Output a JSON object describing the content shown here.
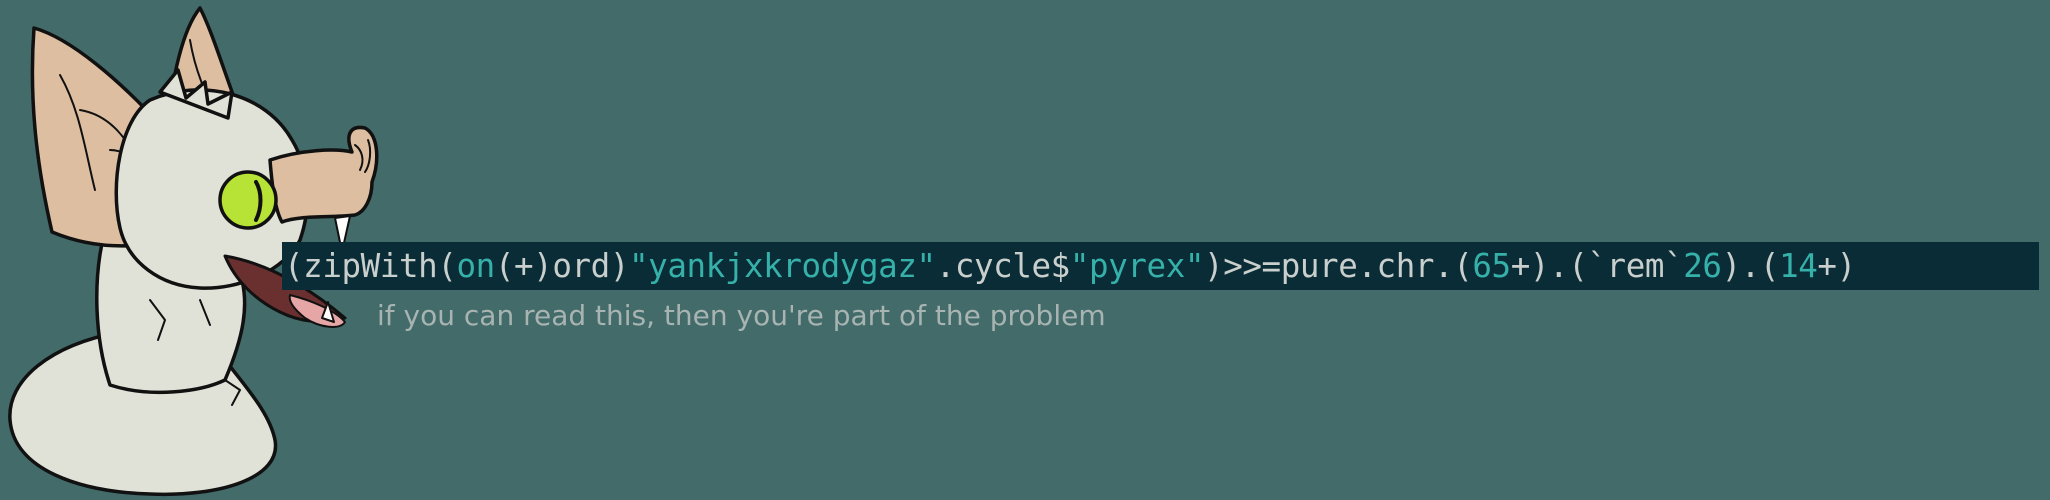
{
  "colors": {
    "background": "#426B6A",
    "code_highlight": "#0A2C36",
    "code_text": "#C9CFCC",
    "code_accent": "#36B1AA",
    "caption_text": "#A7B4B1",
    "fur": "#E1E2D7",
    "skin": "#DDBEA1",
    "eye": "#B7E236",
    "tongue": "#E6A6A6",
    "outline": "#111111"
  },
  "mascot": {
    "icon": "bat-mascot-icon"
  },
  "code": {
    "tokens": [
      {
        "text": "(zipWith(",
        "kind": "plain"
      },
      {
        "text": "on",
        "kind": "accent"
      },
      {
        "text": "(+)ord)",
        "kind": "plain"
      },
      {
        "text": "\"yankjxkrodygaz\"",
        "kind": "accent"
      },
      {
        "text": ".cycle$",
        "kind": "plain"
      },
      {
        "text": "\"pyrex\"",
        "kind": "accent"
      },
      {
        "text": ")>>=pure.chr.(",
        "kind": "plain"
      },
      {
        "text": "65",
        "kind": "accent"
      },
      {
        "text": "+).(`rem`",
        "kind": "plain"
      },
      {
        "text": "26",
        "kind": "accent"
      },
      {
        "text": ").(",
        "kind": "plain"
      },
      {
        "text": "14",
        "kind": "accent"
      },
      {
        "text": "+)",
        "kind": "plain"
      }
    ]
  },
  "caption": {
    "text": "if you can read this, then you're part of the problem"
  }
}
